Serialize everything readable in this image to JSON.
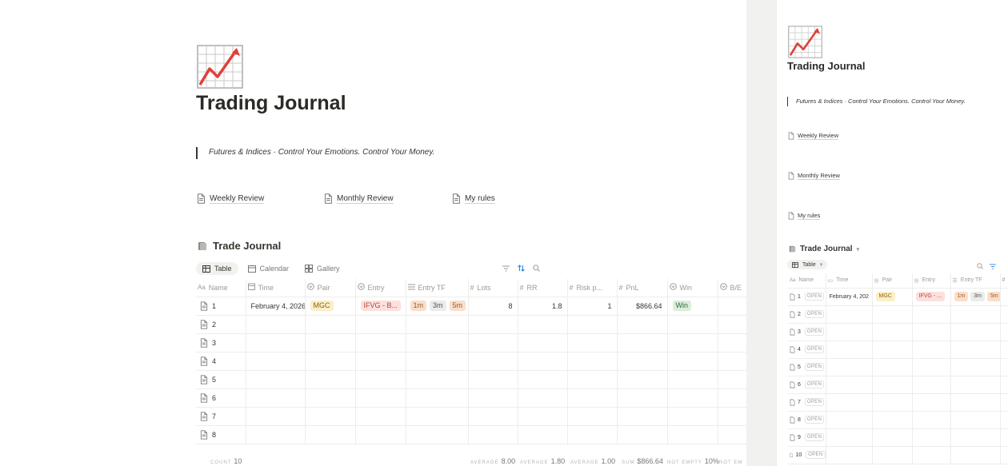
{
  "page": {
    "title": "Trading Journal",
    "quote": "Futures & Indices · Control Your Emotions. Control Your Money.",
    "links": [
      {
        "label": "Weekly Review"
      },
      {
        "label": "Monthly Review"
      },
      {
        "label": "My rules"
      }
    ]
  },
  "database": {
    "title": "Trade Journal",
    "views": [
      {
        "label": "Table",
        "active": true
      },
      {
        "label": "Calendar",
        "active": false
      },
      {
        "label": "Gallery",
        "active": false
      }
    ],
    "columns": [
      {
        "label": "Name",
        "icon": "text-property-icon"
      },
      {
        "label": "Time",
        "icon": "calendar-icon"
      },
      {
        "label": "Pair",
        "icon": "select-icon"
      },
      {
        "label": "Entry",
        "icon": "select-icon"
      },
      {
        "label": "Entry TF",
        "icon": "list-icon"
      },
      {
        "label": "Lots",
        "icon": "number-icon"
      },
      {
        "label": "RR",
        "icon": "number-icon"
      },
      {
        "label": "Risk p...",
        "icon": "number-icon"
      },
      {
        "label": "PnL",
        "icon": "number-icon"
      },
      {
        "label": "Win",
        "icon": "select-icon"
      },
      {
        "label": "B/E",
        "icon": "select-icon"
      }
    ],
    "rows": [
      {
        "name": "1",
        "time": "February 4, 2026",
        "pair": "MGC",
        "entry": "IFVG - B...",
        "entry_tf": [
          "1m",
          "3m",
          "5m"
        ],
        "lots": "8",
        "rr": "1.8",
        "risk": "1",
        "pnl": "$866.64",
        "win": "Win",
        "be": ""
      },
      {
        "name": "2"
      },
      {
        "name": "3"
      },
      {
        "name": "4"
      },
      {
        "name": "5"
      },
      {
        "name": "6"
      },
      {
        "name": "7"
      },
      {
        "name": "8"
      }
    ],
    "footer": {
      "count_label": "COUNT",
      "count": "10",
      "lots_label": "AVERAGE",
      "lots": "8.00",
      "rr_label": "AVERAGE",
      "rr": "1.80",
      "risk_label": "AVERAGE",
      "risk": "1.00",
      "pnl_label": "SUM",
      "pnl": "$866.64",
      "win_label": "NOT EMPTY",
      "win": "10%",
      "be_label": "NOT EM"
    }
  },
  "side": {
    "title": "Trading Journal",
    "quote": "Futures & Indices · Control Your Emotions. Control Your Money.",
    "links": [
      {
        "label": "Weekly Review"
      },
      {
        "label": "Monthly Review"
      },
      {
        "label": "My rules"
      }
    ],
    "db_title": "Trade Journal",
    "view_label": "Table",
    "columns": [
      "Name",
      "Time",
      "Pair",
      "Entry",
      "Entry TF"
    ],
    "open_label": "OPEN",
    "row1": {
      "time": "February 4, 202",
      "pair": "MGC",
      "entry": "IFVG - ...",
      "tf": [
        "1m",
        "3m",
        "5m"
      ]
    },
    "row_names": [
      "1",
      "2",
      "3",
      "4",
      "5",
      "6",
      "7",
      "8",
      "9",
      "10"
    ]
  },
  "colors": {
    "tag_yellow_bg": "#fbeec8",
    "tag_yellow_fg": "#8a6410",
    "tag_red_bg": "#fbe0dc",
    "tag_red_fg": "#b4473c",
    "tag_orange_bg": "#fadec9",
    "tag_orange_fg": "#9a5a22",
    "tag_gray_bg": "#ebebea",
    "tag_gray_fg": "#55534e",
    "tag_green_bg": "#dbeddb",
    "tag_green_fg": "#2f6b3c",
    "accent": "#2383e2"
  }
}
